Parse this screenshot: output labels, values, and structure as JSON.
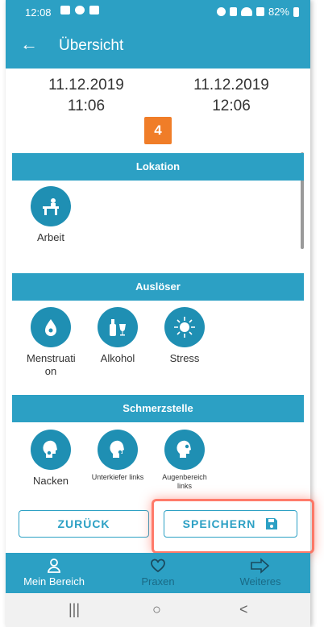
{
  "status": {
    "time": "12:08",
    "battery": "82%"
  },
  "appbar": {
    "title": "Übersicht"
  },
  "episode": {
    "start_date": "11.12.2019",
    "start_time": "11:06",
    "end_date": "11.12.2019",
    "end_time": "12:06",
    "duration": "4"
  },
  "sections": {
    "location": {
      "title": "Lokation",
      "items": [
        {
          "label": "Arbeit",
          "icon": "desk-work-icon"
        }
      ]
    },
    "triggers": {
      "title": "Auslöser",
      "items": [
        {
          "label": "Menstruati on",
          "icon": "menstruation-icon"
        },
        {
          "label": "Alkohol",
          "icon": "alcohol-icon"
        },
        {
          "label": "Stress",
          "icon": "stress-icon"
        }
      ]
    },
    "pain": {
      "title": "Schmerzstelle",
      "items": [
        {
          "label": "Nacken",
          "icon": "neck-icon"
        },
        {
          "label": "Unterkiefer links",
          "icon": "lower-jaw-icon"
        },
        {
          "label": "Augenbereich links",
          "icon": "eye-area-icon"
        }
      ]
    }
  },
  "buttons": {
    "back": "ZURÜCK",
    "save": "SPEICHERN"
  },
  "nav": {
    "my_area": "Mein Bereich",
    "practices": "Praxen",
    "more": "Weiteres"
  },
  "colors": {
    "primary": "#2ca0c4",
    "icon_circle": "#1f8fb3",
    "duration_badge": "#f07d28"
  }
}
